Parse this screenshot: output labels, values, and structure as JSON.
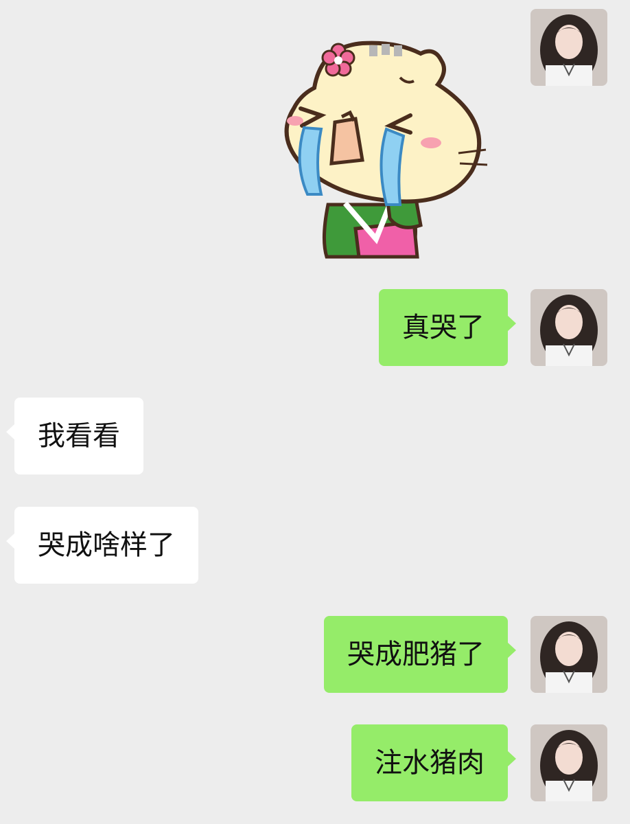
{
  "messages": [
    {
      "side": "me",
      "type": "sticker",
      "sticker": "crying-cat-sticker"
    },
    {
      "side": "me",
      "type": "text",
      "text": "真哭了"
    },
    {
      "side": "them",
      "type": "text",
      "text": "我看看"
    },
    {
      "side": "them",
      "type": "text",
      "text": "哭成啥样了"
    },
    {
      "side": "me",
      "type": "text",
      "text": "哭成肥猪了"
    },
    {
      "side": "me",
      "type": "text",
      "text": "注水猪肉"
    }
  ],
  "colors": {
    "background": "#ededed",
    "my_bubble": "#95ec69",
    "their_bubble": "#ffffff",
    "text": "#111111"
  }
}
